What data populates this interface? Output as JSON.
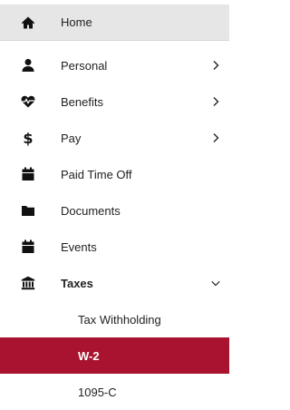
{
  "nav": {
    "home": {
      "label": "Home",
      "icon": "home-icon"
    },
    "personal": {
      "label": "Personal",
      "icon": "person-icon"
    },
    "benefits": {
      "label": "Benefits",
      "icon": "heartbeat-icon"
    },
    "pay": {
      "label": "Pay",
      "icon": "dollar-icon"
    },
    "paid_time_off": {
      "label": "Paid Time Off",
      "icon": "calendar-icon"
    },
    "documents": {
      "label": "Documents",
      "icon": "folder-icon"
    },
    "events": {
      "label": "Events",
      "icon": "calendar-icon"
    },
    "taxes": {
      "label": "Taxes",
      "icon": "bank-icon",
      "expanded": true,
      "children": [
        {
          "label": "Tax Withholding",
          "active": false
        },
        {
          "label": "W-2",
          "active": true
        },
        {
          "label": "1095-C",
          "active": false
        }
      ]
    }
  },
  "colors": {
    "active_bg": "#a9132f",
    "home_bg": "#e6e6e6"
  }
}
